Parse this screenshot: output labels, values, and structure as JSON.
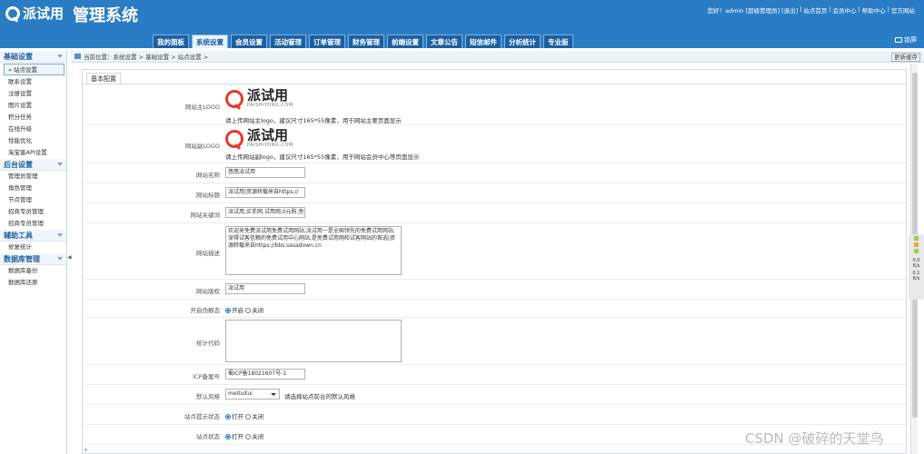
{
  "header": {
    "logo_text": "派试用",
    "system_title": "管理系统",
    "top_links": [
      "您好！admin",
      "[超级管理员]",
      "[退出]",
      "|",
      "站点首页",
      "|",
      "会员中心",
      "|",
      "帮助中心",
      "|",
      "官方网站"
    ],
    "tabs": [
      "我的面板",
      "系统设置",
      "会员设置",
      "活动管理",
      "订单管理",
      "财务管理",
      "前端设置",
      "文章公告",
      "短信邮件",
      "分析统计",
      "专业版"
    ],
    "active_tab": "系统设置",
    "lock_label": "锁屏"
  },
  "sidebar": {
    "sections": [
      {
        "title": "基础设置",
        "items": [
          "站点设置",
          "联系设置",
          "注册设置",
          "图片设置",
          "积分任务",
          "在线升级",
          "性能优化",
          "淘宝客API设置"
        ]
      },
      {
        "title": "后台设置",
        "items": [
          "管理员管理",
          "角色管理",
          "节点管理",
          "招商专员管理",
          "招商专员管理"
        ]
      },
      {
        "title": "辅助工具",
        "items": [
          "修复统计"
        ]
      },
      {
        "title": "数据库管理",
        "items": [
          "数据库备份",
          "数据库还原"
        ]
      }
    ]
  },
  "breadcrumb": {
    "text": "当前位置：系统设置 > 基础设置 > 站点设置 >",
    "refresh_label": "更新缓存"
  },
  "panel": {
    "tab_label": "基本配置"
  },
  "form": {
    "main_logo_label": "网站主LOGO",
    "main_logo_hint": "请上传网站主logo，建议尺寸165*55像素，用于网站主要页面显示",
    "sub_logo_label": "网站副LOGO",
    "sub_logo_hint": "请上传网站副logo，建议尺寸165*55像素，用于网站会员中心等页面显示",
    "logo_brand": "派试用",
    "logo_domain": "PAISHIYONG.COM",
    "site_name_label": "网站名称",
    "site_name_value": "悠悠派试用",
    "site_title_label": "网站标题",
    "site_title_value": "派试用|资源转载来自https://",
    "keywords_label": "网站关键词",
    "keywords_value": "派试用,买手网,试用网,0元购,免",
    "description_label": "网站描述",
    "description_value": "欢迎来免费派试用免费试用网站,派试用一是全国领先的免费试用网站,深得试客信赖的免费试用中心网站,是免费试用网和试客网站的首选|资源转载来自https://bbs.sasadown.cn",
    "copyright_label": "网站版权",
    "copyright_value": "派试用",
    "pseudo_static_label": "开启伪静态",
    "on_label": "开启",
    "off_label": "关闭",
    "stats_code_label": "统计代码",
    "icp_label": "ICP备案号",
    "icp_value": "蜀ICP备18021607号-1",
    "style_label": "默认风格",
    "style_value": "meituitui",
    "style_hint": "请选择站点前台的默认风格",
    "site_notice_label": "站点提示状态",
    "site_status_label": "站点状态",
    "open_label": "打开",
    "close_label": "关闭"
  },
  "widget": {
    "v1": "0.0",
    "v2": "0.1",
    "u1": "K/s",
    "u2": "K/s"
  },
  "watermark": "CSDN @破碎的天堂鸟"
}
